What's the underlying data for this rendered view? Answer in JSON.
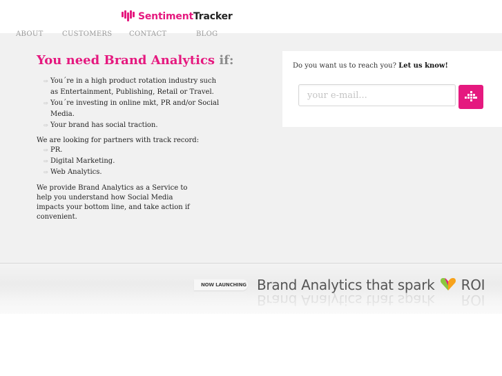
{
  "brand": {
    "name_part1": "Sentiment",
    "name_part2": "Tracker",
    "accent_color": "#e5197f"
  },
  "nav": {
    "items": [
      "ABOUT",
      "CUSTOMERS",
      "CONTACT",
      "BLOG"
    ]
  },
  "headline": {
    "main": "You need Brand Analytics",
    "suffix": "if:"
  },
  "reasons": [
    {
      "line1": "You´re in a high product rotation industry such",
      "line2": "as Entertainment, Publishing, Retail or Travel."
    },
    {
      "line1": "You´re investing in online mkt, PR and/or Social",
      "line2": "Media."
    },
    {
      "line1": "Your brand has social traction.",
      "line2": ""
    }
  ],
  "partners": {
    "intro": "We are looking for partners with track record:",
    "items": [
      "PR.",
      "Digital Marketing.",
      "Web Analytics."
    ]
  },
  "service_text": "We provide Brand Analytics as a Service to help you understand how Social Media impacts your bottom line, and take action if convenient.",
  "contact": {
    "question": "Do you want us to reach you?",
    "cta": "Let us know!",
    "email_placeholder": "your e-mail...",
    "submit_icon": "pixel-arrow-icon"
  },
  "banner": {
    "badge": "NOW LAUNCHING",
    "tagline_part1": "Brand Analytics that spark",
    "tagline_part2": "ROI",
    "icon": "heart-icon"
  }
}
